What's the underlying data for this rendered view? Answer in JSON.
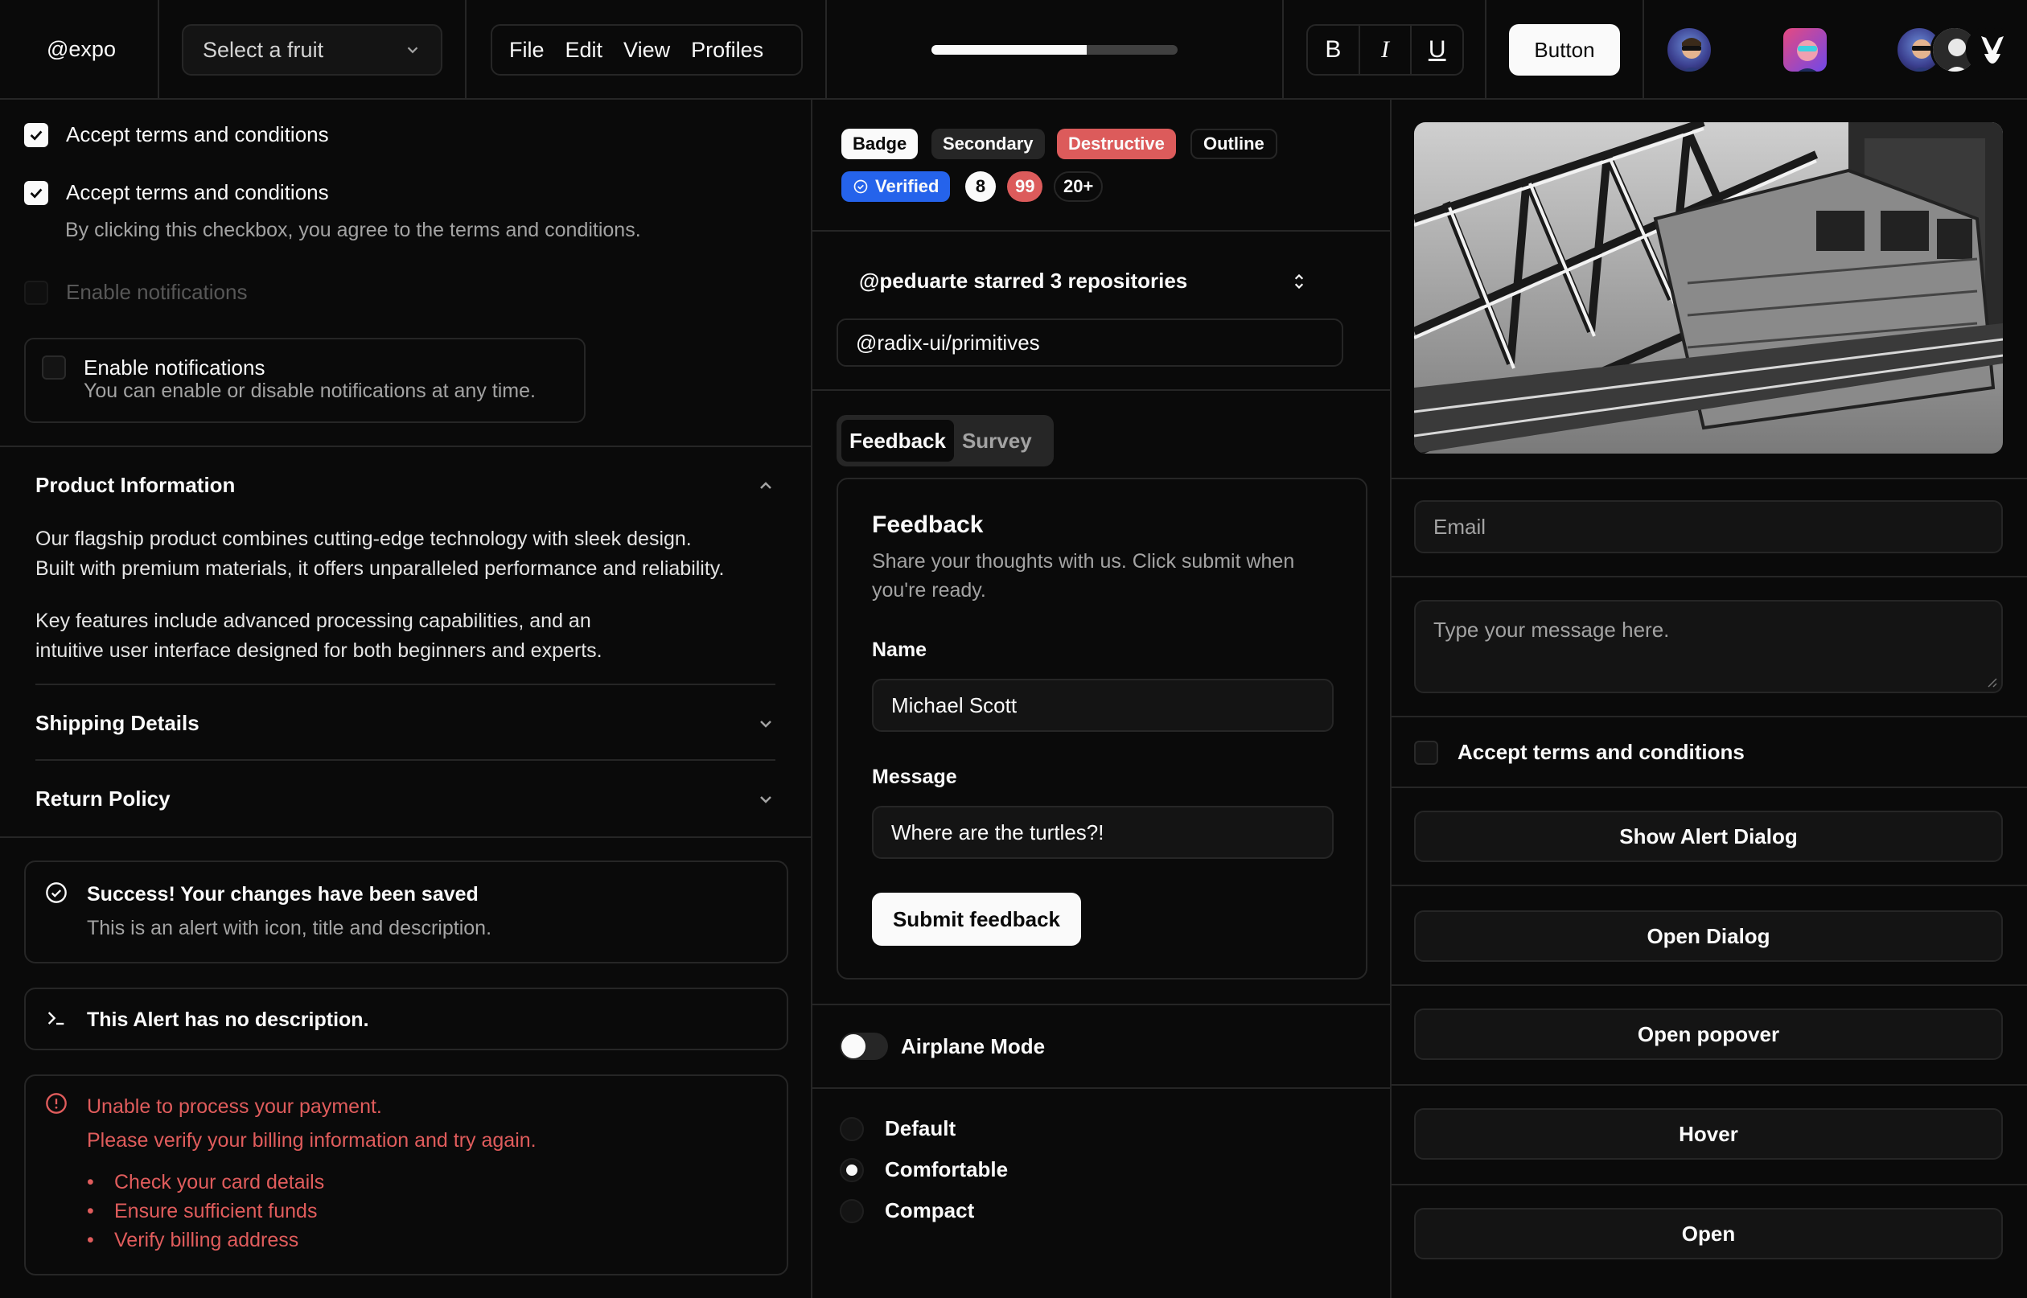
{
  "topbar": {
    "logo": "@expo",
    "select_placeholder": "Select a fruit",
    "menus": [
      "File",
      "Edit",
      "View",
      "Profiles"
    ],
    "progress_percent": 63,
    "format": [
      "B",
      "I",
      "U"
    ],
    "button_label": "Button"
  },
  "left": {
    "checkbox1_label": "Accept terms and conditions",
    "checkbox2_label": "Accept terms and conditions",
    "checkbox2_desc": "By clicking this checkbox, you agree to the terms and conditions.",
    "checkbox3_label": "Enable notifications",
    "card_title": "Enable notifications",
    "card_desc": "You can enable or disable notifications at any time.",
    "accordion": {
      "item1_title": "Product Information",
      "item1_p1_l1": "Our flagship product combines cutting-edge technology with sleek design.",
      "item1_p1_l2": "Built with premium materials, it offers unparalleled performance and reliability.",
      "item1_p2_l1": "Key features include advanced processing capabilities, and an",
      "item1_p2_l2": "intuitive user interface designed for both beginners and experts.",
      "item2_title": "Shipping Details",
      "item3_title": "Return Policy"
    },
    "alert1_title": "Success! Your changes have been saved",
    "alert1_desc": "This is an alert with icon, title and description.",
    "alert2_title": "This Alert has no description.",
    "alert3_title": "Unable to process your payment.",
    "alert3_desc": "Please verify your billing information and try again.",
    "alert3_items": [
      "Check your card details",
      "Ensure sufficient funds",
      "Verify billing address"
    ]
  },
  "middle": {
    "badges": {
      "badge": "Badge",
      "secondary": "Secondary",
      "destructive": "Destructive",
      "outline": "Outline",
      "verified": "Verified",
      "count1": "8",
      "count2": "99",
      "count3": "20+"
    },
    "collapsible_title": "@peduarte starred 3 repositories",
    "collapsible_item": "@radix-ui/primitives",
    "tabs": [
      "Feedback",
      "Survey"
    ],
    "form": {
      "title": "Feedback",
      "desc_l1": "Share your thoughts with us. Click submit when",
      "desc_l2": "you're ready.",
      "name_label": "Name",
      "name_value": "Michael Scott",
      "message_label": "Message",
      "message_value": "Where are the turtles?!",
      "submit": "Submit feedback"
    },
    "switch_label": "Airplane Mode",
    "radio_options": [
      "Default",
      "Comfortable",
      "Compact"
    ],
    "radio_selected": "Comfortable"
  },
  "right": {
    "email_placeholder": "Email",
    "message_placeholder": "Type your message here.",
    "checkbox_label": "Accept terms and conditions",
    "buttons": [
      "Show Alert Dialog",
      "Open Dialog",
      "Open popover",
      "Hover",
      "Open"
    ]
  },
  "colors": {
    "background": "#0a0a0a",
    "border": "#262626",
    "destructive": "#dc5b5b",
    "verified_blue": "#2563eb"
  }
}
